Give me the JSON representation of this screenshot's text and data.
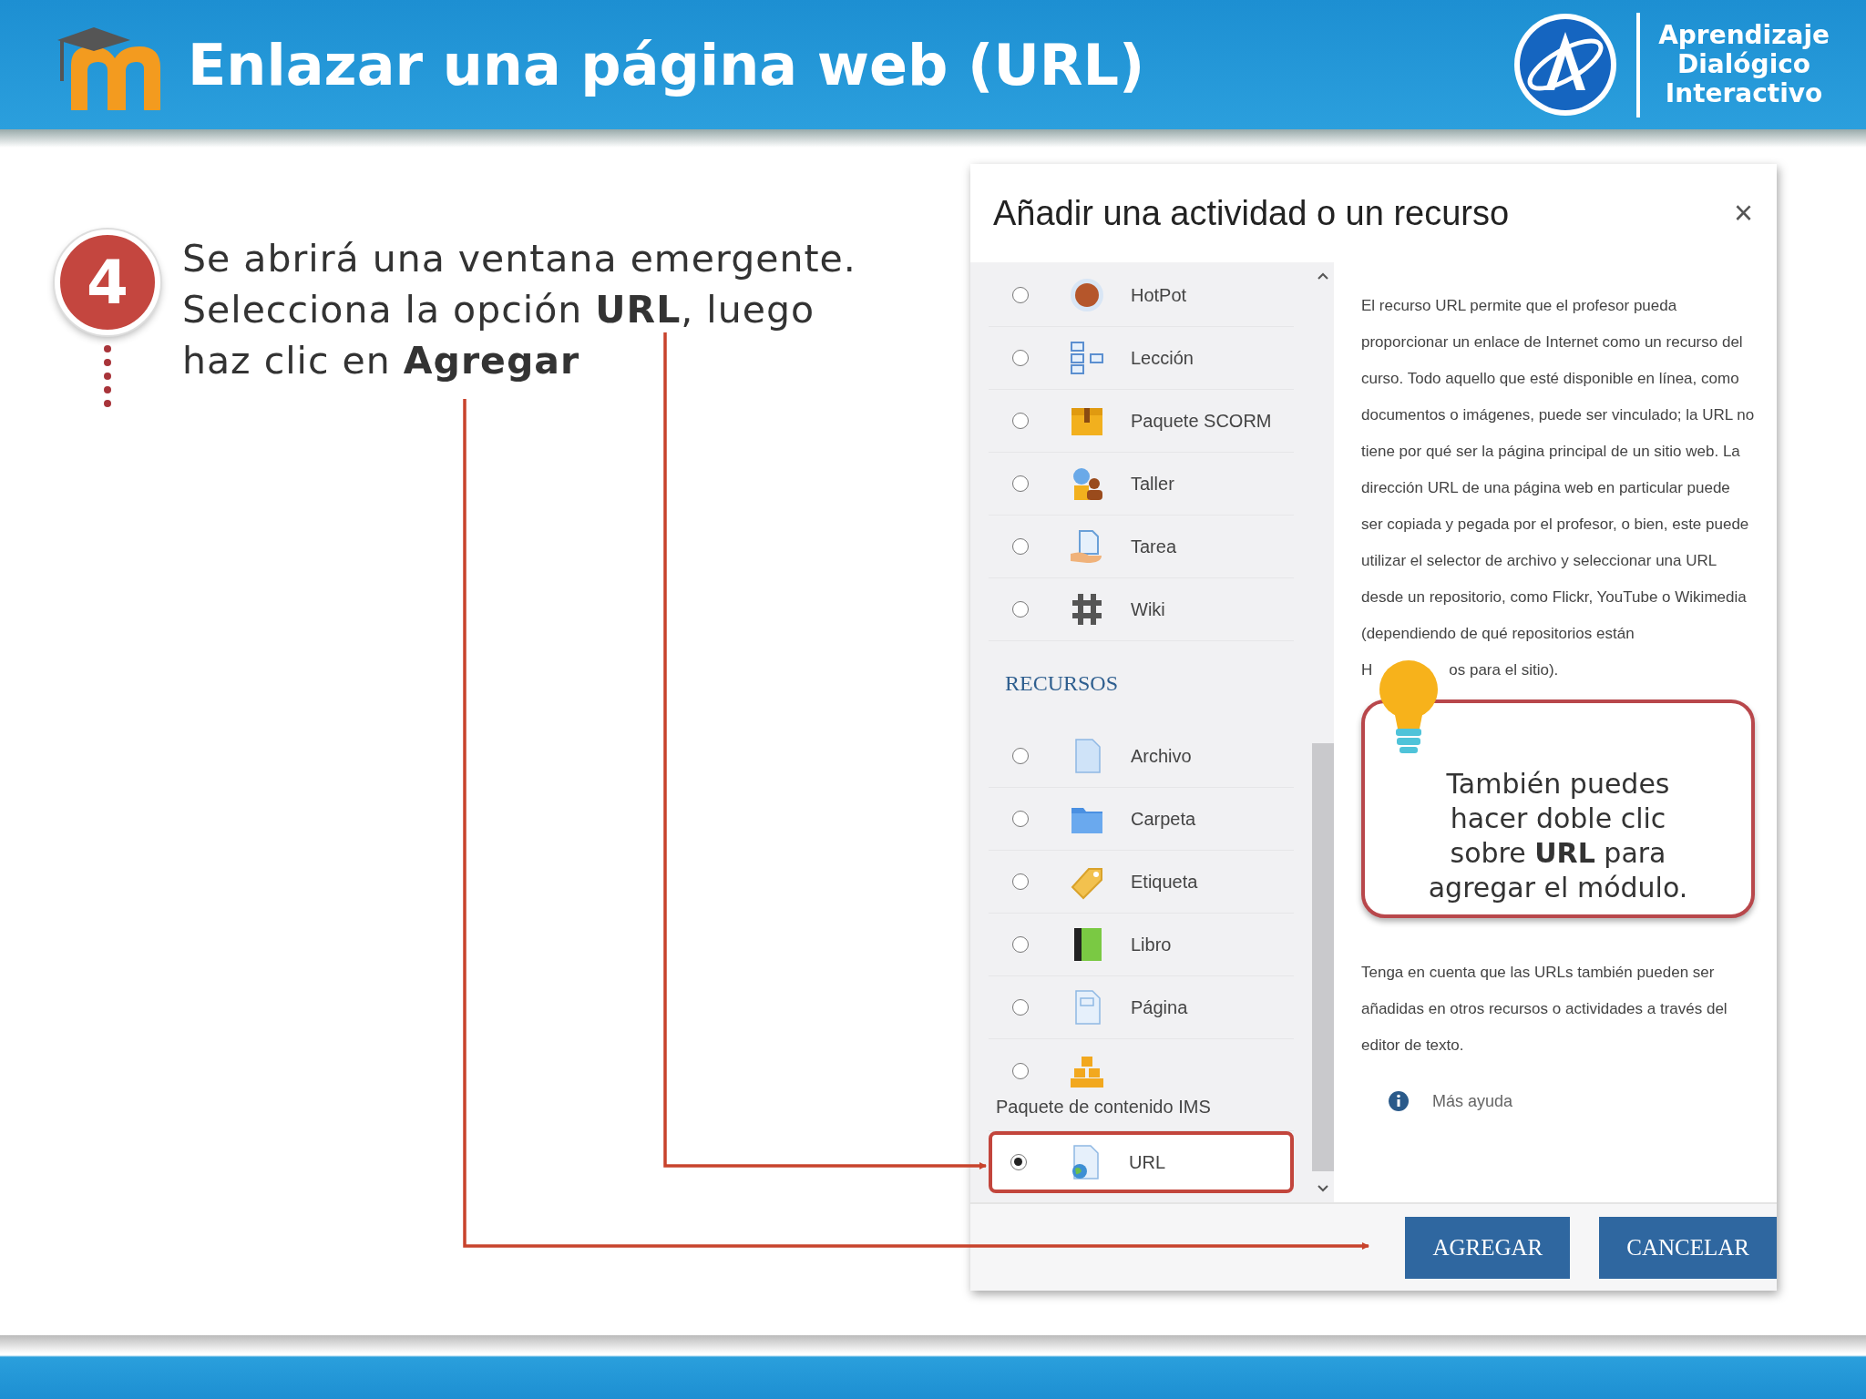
{
  "header": {
    "title": "Enlazar una página web (URL)",
    "brand_lines": [
      "Aprendizaje",
      "Dialógico",
      "Interactivo"
    ]
  },
  "step": {
    "number": "4",
    "text": "Se abrirá una ventana emergente. Selecciona la opción **URL**, luego haz clic en **Agregar**"
  },
  "dialog": {
    "title": "Añadir una actividad o un recurso",
    "close": "×",
    "items": [
      {
        "kind": "item",
        "label": "HotPot",
        "selected": false,
        "highlighted": false
      },
      {
        "kind": "item",
        "label": "Lección",
        "selected": false,
        "highlighted": false
      },
      {
        "kind": "item",
        "label": "Paquete SCORM",
        "selected": false,
        "highlighted": false
      },
      {
        "kind": "item",
        "label": "Taller",
        "selected": false,
        "highlighted": false
      },
      {
        "kind": "item",
        "label": "Tarea",
        "selected": false,
        "highlighted": false
      },
      {
        "kind": "item",
        "label": "Wiki",
        "selected": false,
        "highlighted": false
      },
      {
        "kind": "heading",
        "label": "RECURSOS"
      },
      {
        "kind": "item",
        "label": "Archivo",
        "selected": false,
        "highlighted": false
      },
      {
        "kind": "item",
        "label": "Carpeta",
        "selected": false,
        "highlighted": false
      },
      {
        "kind": "item",
        "label": "Etiqueta",
        "selected": false,
        "highlighted": false
      },
      {
        "kind": "item",
        "label": "Libro",
        "selected": false,
        "highlighted": false
      },
      {
        "kind": "item",
        "label": "Página",
        "selected": false,
        "highlighted": false
      },
      {
        "kind": "stacked",
        "label": "Paquete de contenido IMS",
        "selected": false,
        "highlighted": false
      },
      {
        "kind": "item",
        "label": "URL",
        "selected": true,
        "highlighted": true
      }
    ],
    "help_text": "El recurso URL permite que el profesor pueda proporcionar un enlace de Internet como un recurso del curso. Todo aquello que esté disponible en línea, como documentos o imágenes, puede ser vinculado; la URL no tiene por qué ser la página principal de un sitio web. La dirección URL de una página web en particular puede ser copiada y pegada por el profesor, o bien, este puede utilizar el selector de archivo y seleccionar una URL desde un repositorio, como Flickr, YouTube o Wikimedia (dependiendo de qué repositorios están",
    "help_fragments": [
      "H",
      "os para el sitio)."
    ],
    "callout": "También puedes hacer doble clic sobre **URL** para agregar el módulo.",
    "note": "Tenga en cuenta que las URLs también pueden ser añadidas en otros recursos o actividades a través del editor de texto.",
    "help_link": "Más ayuda",
    "buttons": [
      "AGREGAR",
      "CANCELAR"
    ]
  }
}
